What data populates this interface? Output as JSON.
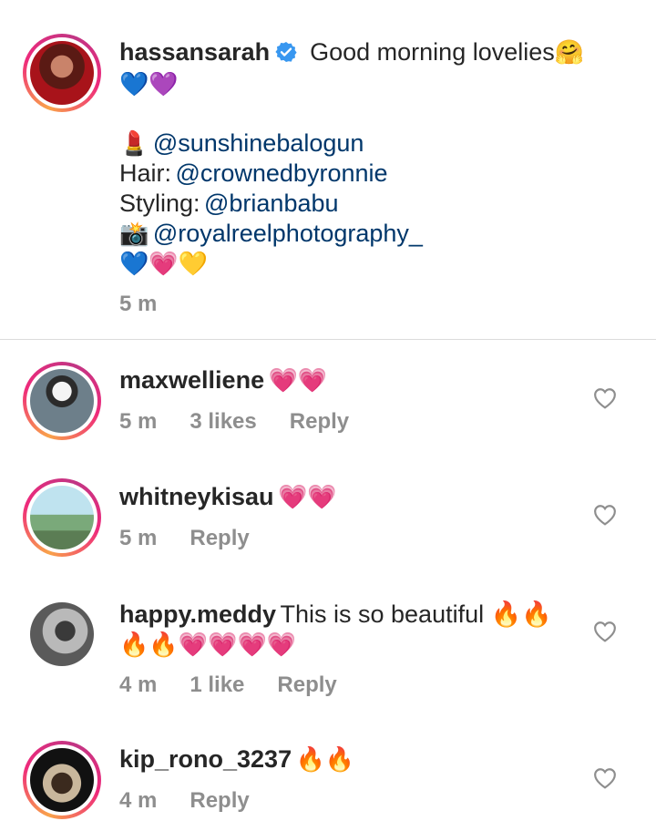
{
  "caption": {
    "username": "hassansarah",
    "text": "Good morning lovelies",
    "emoji_line1": "🤗",
    "emoji_line2": "💙💜",
    "credits": [
      {
        "prefix": "💄",
        "handle": "@sunshinebalogun"
      },
      {
        "prefix": "Hair:",
        "handle": "@crownedbyronnie"
      },
      {
        "prefix": "Styling:",
        "handle": "@brianbabu"
      },
      {
        "prefix": "📸",
        "handle": "@royalreelphotography_"
      }
    ],
    "emoji_line3": "💙💗💛",
    "time": "5 m"
  },
  "comments": [
    {
      "username": "maxwelliene",
      "text": "💗💗",
      "time": "5 m",
      "likes": "3 likes",
      "reply": "Reply"
    },
    {
      "username": "whitneykisau",
      "text": "💗💗",
      "time": "5 m",
      "likes": "",
      "reply": "Reply"
    },
    {
      "username": "happy.meddy",
      "text": "This is so beautiful 🔥🔥",
      "text2": "🔥🔥💗💗💗💗",
      "time": "4 m",
      "likes": "1 like",
      "reply": "Reply"
    },
    {
      "username": "kip_rono_3237",
      "text": "🔥🔥",
      "time": "4 m",
      "likes": "",
      "reply": "Reply"
    }
  ],
  "colors": {
    "link": "#00376b",
    "meta": "#8e8e8e",
    "verified": "#3897f0",
    "divider": "#dbdbdb"
  },
  "icons": {
    "verified": "verified-badge-icon",
    "like": "heart-outline-icon"
  }
}
